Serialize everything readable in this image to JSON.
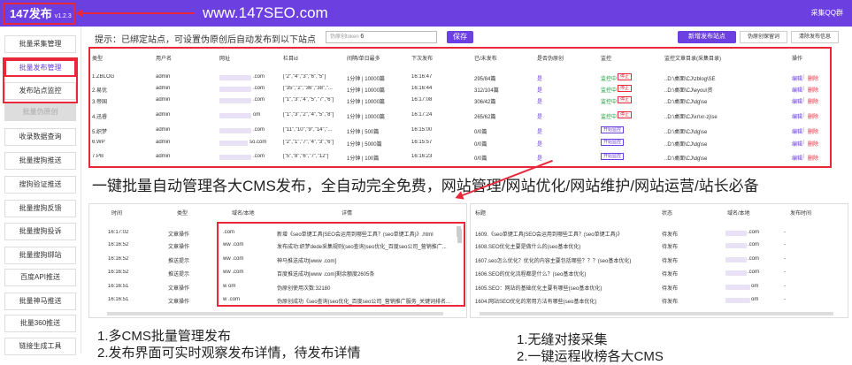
{
  "header": {
    "logo": "147发布",
    "version": "v1.2.3",
    "site": "www.147SEO.com",
    "qq": "采集QQ群"
  },
  "sidebar": {
    "items": [
      "批量采集管理",
      "批量发布管理",
      "发布站点监控",
      "批量伪原创",
      "收录数据查询",
      "批量搜狗推送",
      "搜狗验证推送",
      "批量搜狗反馈",
      "批量搜狗投诉",
      "批量搜狗绑站",
      "百度API推送",
      "批量神马推送",
      "批量360推送",
      "链接生成工具"
    ]
  },
  "toolbar": {
    "tip": "提示：已绑定站点，可设置伪原创后自动发布到以下站点",
    "input_placeholder": "伪原创token",
    "input_value": "6",
    "save": "保存",
    "new_site": "新增发布站点",
    "pseudo": "伪原创保留词",
    "clear": "清除发布信息"
  },
  "sites": {
    "headers": [
      "类型",
      "用户名",
      "网址",
      "栏目id",
      "间隔/单日最多",
      "下次发布",
      "已/未发布",
      "是否伪原创",
      "监控",
      "监控文章目录(采集目录)",
      "操作"
    ],
    "rows": [
      {
        "type": "1.ZBLOG",
        "user": "admin",
        "url": ".com",
        "col": "[\"2\",\"4\",\"3\",\"6\",\"5\"]",
        "interval": "1分钟 | 10000篇",
        "next": "16:16:47",
        "count": "295/84篇",
        "pseudo": "是",
        "mon": "监控中",
        "stop": "停止",
        "dir": "..D:\\桌面\\CJ\\zblog\\SE",
        "edit": "编辑",
        "del": "删除"
      },
      {
        "type": "2.易优",
        "user": "admin",
        "url": ".com",
        "col": "[\"35\",\"2\",\"36\",\"38\",\"...",
        "interval": "1分钟 | 10000篇",
        "next": "16:16:44",
        "count": "312/104篇",
        "pseudo": "是",
        "mon": "监控中",
        "stop": "停止",
        "dir": "..D:\\桌面\\CJ\\eyou\\资",
        "edit": "编辑",
        "del": "删除"
      },
      {
        "type": "3.帝国",
        "user": "admin",
        "url": ".com",
        "col": "[\"1\",\"3\",\"4\",\"5\",\"7\",\"6\"]",
        "interval": "1分钟 | 10000篇",
        "next": "16:17:08",
        "count": "306/42篇",
        "pseudo": "是",
        "mon": "监控中",
        "stop": "停止",
        "dir": "..D:\\桌面\\CJ\\dg\\se",
        "edit": "编辑",
        "del": "删除"
      },
      {
        "type": "4.迅睿",
        "user": "admin",
        "url": "om",
        "col": "[\"1\",\"3\",\"2\",\"4\",\"5\",\"8\"]",
        "interval": "1分钟 | 10000篇",
        "next": "16:17:24",
        "count": "265/62篇",
        "pseudo": "是",
        "mon": "监控中",
        "stop": "停止",
        "dir": "..D:\\桌面\\CJ\\xr\\xr-zj\\se",
        "edit": "编辑",
        "del": "删除"
      },
      {
        "type": "5.织梦",
        "user": "admin",
        "url": ".com",
        "col": "[\"11\",\"10\",\"9\",\"14\",\"...",
        "interval": "1分钟 | 500篇",
        "next": "16:15:00",
        "count": "0/0篇",
        "pseudo": "是",
        "mon": "开始监控",
        "stop": "",
        "dir": "..D:\\桌面\\CJ\\dg\\se",
        "edit": "编辑",
        "del": "删除"
      },
      {
        "type": "6.WP",
        "user": "admin",
        "url": "so.com",
        "col": "[\"2\",\"1\",\"7\",\"4\",\"3\",\"6\"]",
        "interval": "1分钟 | 5000篇",
        "next": "16:15:57",
        "count": "0/0篇",
        "pseudo": "是",
        "mon": "开始监控",
        "stop": "",
        "dir": "..D:\\桌面\\CJ\\dg\\se",
        "edit": "编辑",
        "del": "删除"
      },
      {
        "type": "7.PB",
        "user": "admin",
        "url": ".com",
        "col": "[\"5\",\"8\",\"6\",\"7\",\"12\"]",
        "interval": "1分钟 | 100篇",
        "next": "16:16:23",
        "count": "0/0篇",
        "pseudo": "是",
        "mon": "开始监控",
        "stop": "",
        "dir": "..D:\\桌面\\CJ\\dg\\se",
        "edit": "编辑",
        "del": "删除"
      }
    ]
  },
  "caption": "一键批量自动管理各大CMS发布，全自动完全免费，网站管理/网站优化/网站维护/网站运营/站长必备",
  "log": {
    "headers": [
      "时间",
      "类型",
      "域名/本地",
      "详情"
    ],
    "rows": [
      {
        "time": "16:17:02",
        "type": "文章操作",
        "domain": ".com",
        "detail": "新增《seo单键工具|SEO会运用到哪些工具？(seo单键工具)》.html"
      },
      {
        "time": "16:16:52",
        "type": "文章操作",
        "domain": "ww         .com",
        "detail": "发布成功:织梦dede采集规则(seo查询)seo优化_百度seo公司_营销推广..."
      },
      {
        "time": "16:16:52",
        "type": "推送提示",
        "domain": "ww         .com",
        "detail": "神马推送成功[www            .com]"
      },
      {
        "time": "16:16:52",
        "type": "推送提示",
        "domain": "ww         .com",
        "detail": "百度推送成功[www            .com]剩余额度2605条"
      },
      {
        "time": "16:16:51",
        "type": "文章操作",
        "domain": "w           om",
        "detail": "伪原创使用次数:32180"
      },
      {
        "time": "16:16:51",
        "type": "文章操作",
        "domain": "w           .com",
        "detail": "伪原创成功《seo查询(seo优化_百度seo公司_营销推广服务_关键词排名..."
      }
    ]
  },
  "articles": {
    "headers": [
      "标题",
      "状态",
      "域名/本地",
      "发布时间"
    ],
    "rows": [
      {
        "title": "1609.《seo单键工具|SEO会运用到哪些工具？(seo单键工具)》",
        "status": "待发布",
        "domain": ".com",
        "time": "-"
      },
      {
        "title": "1608.SEO优化主要是做什么的(seo基本优化)",
        "status": "待发布",
        "domain": ".com",
        "time": "-"
      },
      {
        "title": "1607.seo怎么优化？优化的内容主要包括哪些？？？(seo基本优化)",
        "status": "待发布",
        "domain": ".com",
        "time": "-"
      },
      {
        "title": "1606.SEO的优化流程都是什么？(seo基本优化)",
        "status": "待发布",
        "domain": ".com",
        "time": "-"
      },
      {
        "title": "1605.SEO：网站的基础优化主要有哪些(seo基本优化)",
        "status": "待发布",
        "domain": "om",
        "time": "-"
      },
      {
        "title": "1604.网站SEO优化的常用方法有哪些(seo基本优化)",
        "status": "待发布",
        "domain": "om",
        "time": "-"
      }
    ]
  },
  "bottom": {
    "left1": "1.多CMS批量管理发布",
    "left2": "2.发布界面可实时观察发布详情，待发布详情",
    "right1": "1.无缝对接采集",
    "right2": "2.一键运程收榜各大CMS"
  }
}
